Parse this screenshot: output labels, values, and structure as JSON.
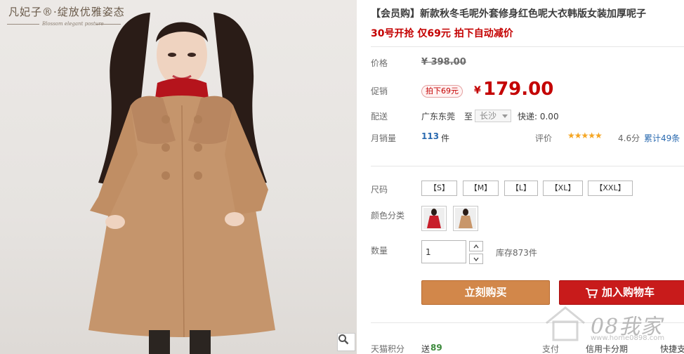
{
  "image": {
    "brand_name": "凡妃子",
    "brand_slogan": "绽放优雅姿态",
    "brand_tagline": "Blossom elegant posture",
    "zoom_icon": "magnifier-icon"
  },
  "product": {
    "title": "【会员购】新款秋冬毛呢外套修身红色呢大衣韩版女装加厚呢子",
    "subtitle": "30号开抢 仅69元 拍下自动减价"
  },
  "price": {
    "label": "价格",
    "original": "¥ 398.00"
  },
  "promo": {
    "label": "促销",
    "tag": "拍下69元",
    "currency": "¥",
    "value": "179.00"
  },
  "shipping": {
    "label": "配送",
    "from": "广东东莞",
    "to_word": "至",
    "city": "长沙",
    "fee": "快递: 0.00"
  },
  "sales": {
    "label": "月销量",
    "count": "113",
    "unit": "件",
    "rating_label": "评价",
    "stars": "★★★★★",
    "rating": "4.6分",
    "reviews": "累计49条"
  },
  "size": {
    "label": "尺码",
    "options": [
      "【S】",
      "【M】",
      "【L】",
      "【XL】",
      "【XXL】"
    ]
  },
  "color": {
    "label": "颜色分类",
    "options": [
      "红色",
      "驼色"
    ],
    "colors": [
      "#c81e2a",
      "#c8966a"
    ]
  },
  "quantity": {
    "label": "数量",
    "value": "1",
    "stock": "库存873件"
  },
  "actions": {
    "buy_now": "立刻购买",
    "add_to_cart": "加入购物车"
  },
  "footer": {
    "points_label": "天猫积分",
    "points_prefix": "送",
    "points_value": "89",
    "pay_label": "支付",
    "credit_card": "信用卡分期",
    "express": "快捷支"
  },
  "watermark": {
    "text": "08我家",
    "url": "www.home0898.com"
  }
}
